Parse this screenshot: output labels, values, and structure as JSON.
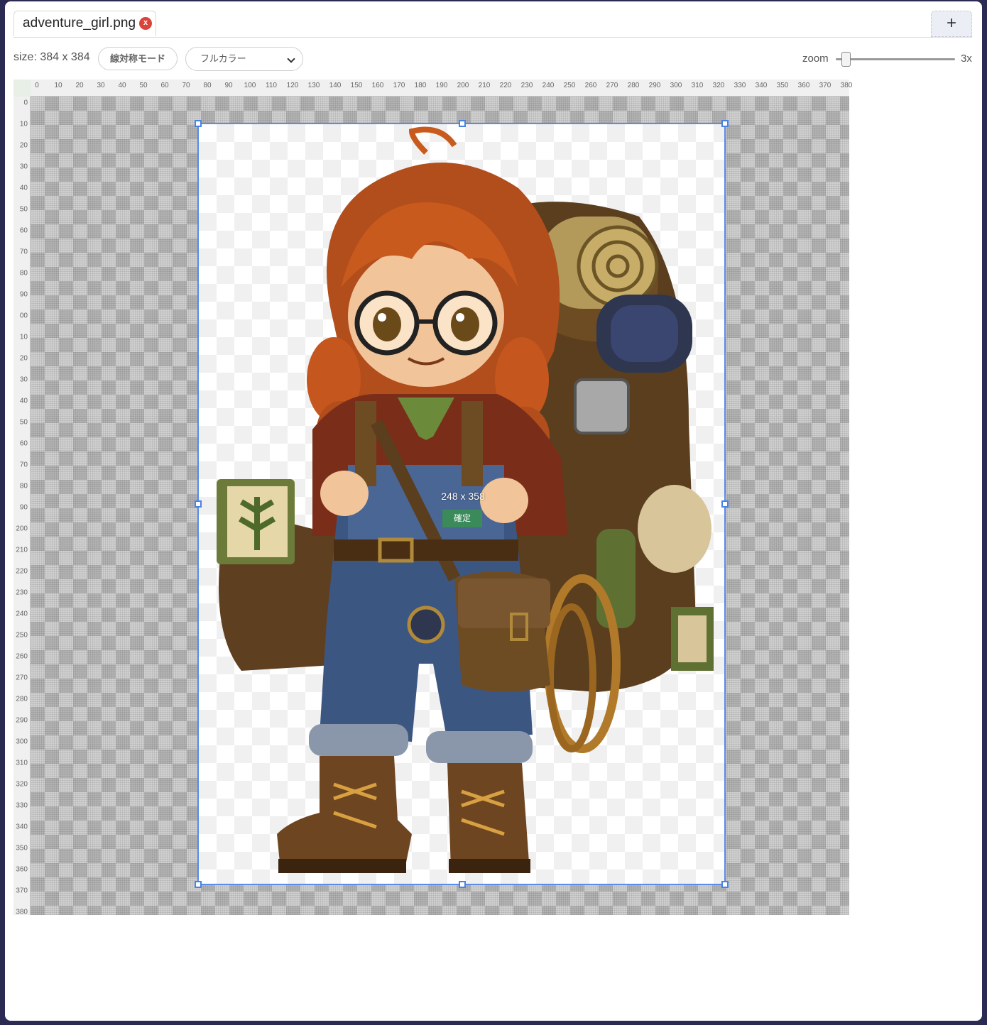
{
  "tab": {
    "filename": "adventure_girl.png",
    "close_label": "x",
    "add_label": "+"
  },
  "toolbar": {
    "size_text": "size: 384 x 384",
    "mode_button": "線対称モード",
    "color_select": "フルカラー",
    "zoom_label": "zoom",
    "zoom_value": "3x",
    "zoom_level_fraction": 0.05
  },
  "ruler": {
    "top_ticks": [
      "0",
      "10",
      "20",
      "30",
      "40",
      "50",
      "60",
      "70",
      "80",
      "90",
      "100",
      "110",
      "120",
      "130",
      "140",
      "150",
      "160",
      "170",
      "180",
      "190",
      "200",
      "210",
      "220",
      "230",
      "240",
      "250",
      "260",
      "270",
      "280",
      "290",
      "300",
      "310",
      "320",
      "330",
      "340",
      "350",
      "360",
      "370",
      "380"
    ],
    "left_ticks": [
      "0",
      "10",
      "20",
      "30",
      "40",
      "50",
      "60",
      "70",
      "80",
      "90",
      "00",
      "10",
      "20",
      "30",
      "40",
      "50",
      "60",
      "70",
      "80",
      "90",
      "200",
      "210",
      "220",
      "230",
      "240",
      "250",
      "260",
      "270",
      "280",
      "290",
      "300",
      "310",
      "320",
      "330",
      "340",
      "350",
      "360",
      "370",
      "380"
    ]
  },
  "selection": {
    "size_text": "248 x 358",
    "confirm_label": "確定"
  },
  "colors": {
    "accent": "#4a82e4",
    "confirm": "#3a8a5a",
    "close": "#d9453a"
  }
}
